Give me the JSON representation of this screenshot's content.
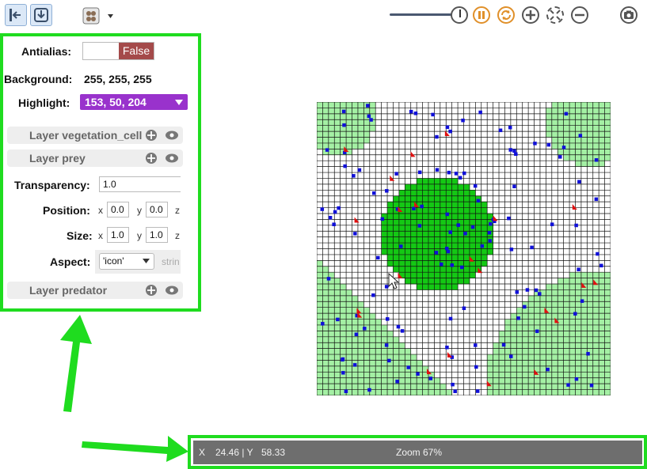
{
  "toolbar": {
    "left_buttons": [
      {
        "icon": "panel-collapse-left-icon"
      },
      {
        "icon": "download-icon"
      }
    ],
    "layers_menu_icon": "layers-dropdown-icon",
    "sim_controls": [
      {
        "icon": "pause-icon",
        "color": "#e0902a"
      },
      {
        "icon": "sync-icon",
        "color": "#e0902a"
      },
      {
        "icon": "zoom-in-icon"
      },
      {
        "icon": "zoom-fit-icon"
      },
      {
        "icon": "zoom-out-icon"
      },
      {
        "icon": "camera-icon"
      }
    ],
    "speed_slider": 0.85
  },
  "panel": {
    "antialias_label": "Antialias:",
    "antialias_value": "False",
    "background_label": "Background:",
    "background_value": "255, 255, 255",
    "highlight_label": "Highlight:",
    "highlight_value": "153, 50, 204",
    "highlight_color": "#9932cc",
    "layers": [
      {
        "name": "Layer vegetation_cell",
        "expanded": false
      },
      {
        "name": "Layer prey",
        "expanded": true
      },
      {
        "name": "Layer predator",
        "expanded": false
      }
    ],
    "prey": {
      "transparency_label": "Transparency:",
      "transparency_value": "1.0",
      "position_label": "Position:",
      "position_x": "0.0",
      "position_y": "0.0",
      "size_label": "Size:",
      "size_x": "1.0",
      "size_y": "1.0",
      "aspect_label": "Aspect:",
      "aspect_value": "'icon'",
      "aspect_extra": "strin",
      "axis_x": "x",
      "axis_y": "y",
      "axis_z": "z"
    }
  },
  "status": {
    "x_label": "X",
    "x_value": "24.46 | Y",
    "y_value": "58.33",
    "zoom": "Zoom 67%"
  },
  "colors": {
    "highlight_green": "#1fdc1f",
    "veg_light": "#a4f0a4",
    "veg_bright": "#14c814",
    "prey": "#1010d8",
    "predator": "#e01010",
    "antialias_false": "#a44a4a"
  }
}
